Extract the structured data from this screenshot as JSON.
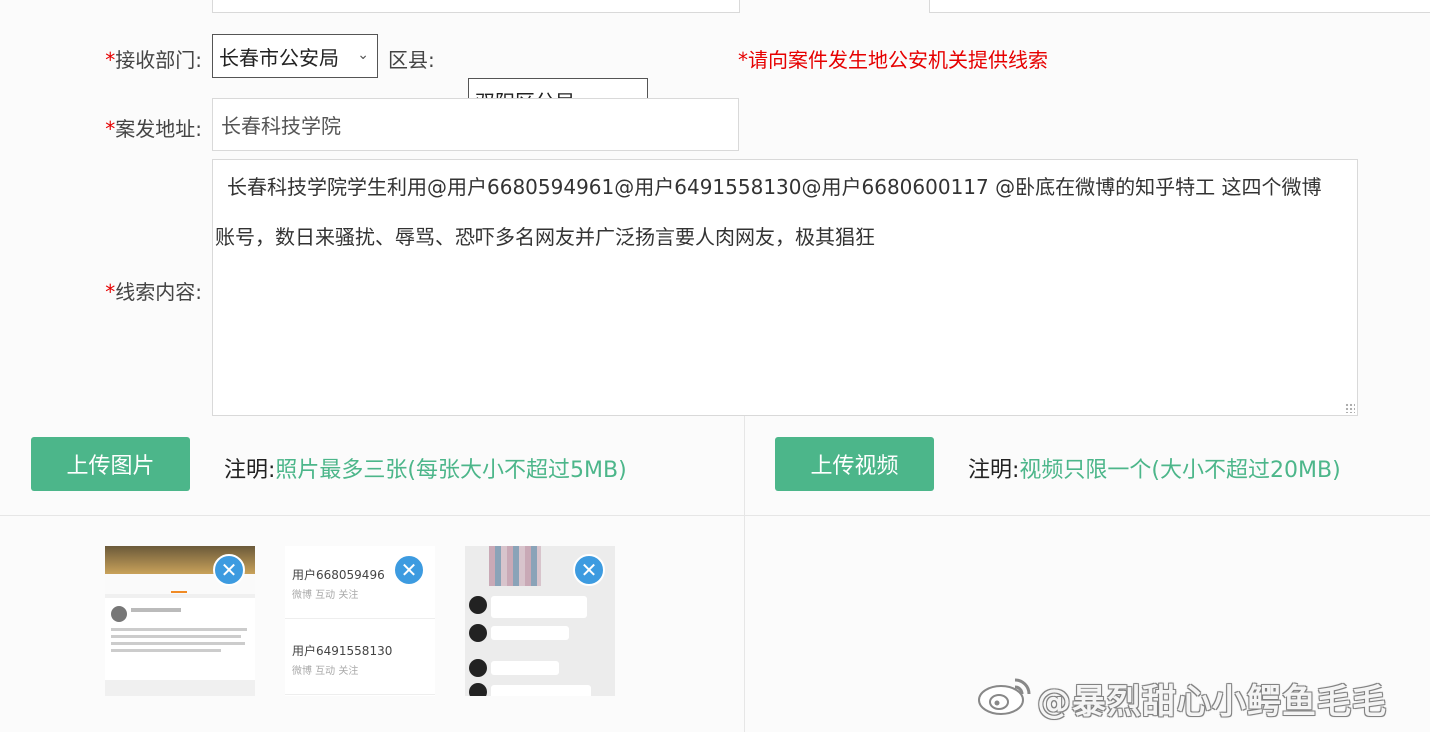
{
  "form": {
    "required_mark": "*",
    "dept": {
      "label": "接收部门:",
      "value": "长春市公安局"
    },
    "county": {
      "label": "区县:",
      "value": "双阳区分局"
    },
    "dept_notice": "*请向案件发生地公安机关提供线索",
    "address": {
      "label": "案发地址:",
      "value": "长春科技学院"
    },
    "clue": {
      "label": "线索内容:",
      "line1": "长春科技学院学生利用@用户6680594961@用户6491558130@用户6680600117 @卧底在微博的知乎特工 这四个微博",
      "line2": "账号，数日来骚扰、辱骂、恐吓多名网友并广泛扬言要人肉网友，极其猖狂"
    }
  },
  "upload": {
    "image_button": "上传图片",
    "image_hint_key": "注明:",
    "image_hint_value": "照片最多三张(每张大小不超过5MB)",
    "video_button": "上传视频",
    "video_hint_key": "注明:",
    "video_hint_value": "视频只限一个(大小不超过20MB)"
  },
  "thumbnails": {
    "remove_glyph": "✕",
    "thumb2": {
      "user1_name": "用户668059496",
      "user1_sub": "微博 互动 关注",
      "user2_name": "用户6491558130",
      "user2_sub": "微博 互动 关注"
    }
  },
  "watermark": "@暴烈甜心小鳄鱼毛毛",
  "colors": {
    "accent_green": "#4cb68a",
    "required_red": "#e60000",
    "remove_blue": "#3d9be0"
  },
  "icons": {
    "dropdown": "chevron-down-icon",
    "remove": "close-icon",
    "watermark_logo": "weibo-icon"
  }
}
